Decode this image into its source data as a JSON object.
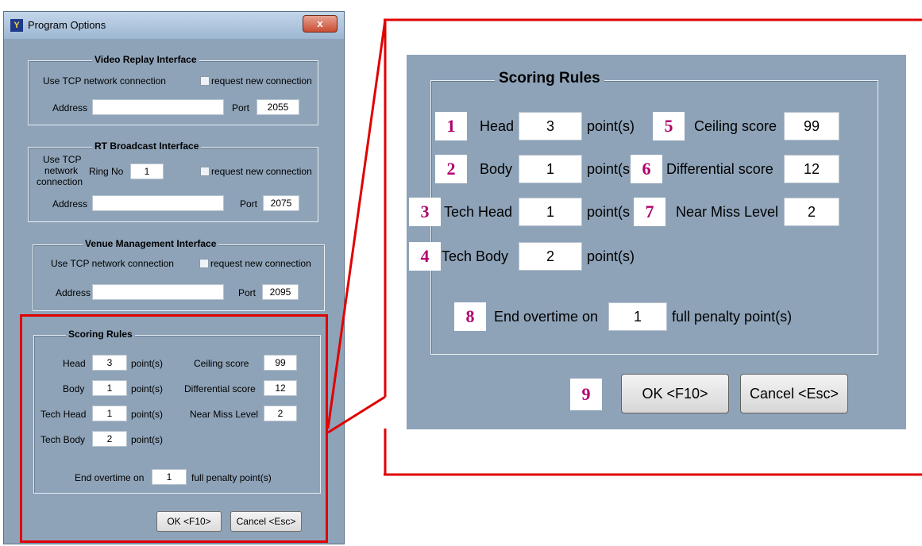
{
  "window": {
    "title": "Program Options",
    "close": "x",
    "app_icon": "app-icon"
  },
  "video": {
    "title": "Video Replay Interface",
    "use_tcp": "Use TCP network connection",
    "request": "request new connection",
    "address_label": "Address",
    "address_value": "",
    "port_label": "Port",
    "port_value": "2055"
  },
  "rt": {
    "title": "RT Broadcast Interface",
    "use_tcp_1": "Use TCP",
    "use_tcp_2": "network",
    "use_tcp_3": "connection",
    "ring_label": "Ring No",
    "ring_value": "1",
    "request": "request new connection",
    "address_label": "Address",
    "address_value": "",
    "port_label": "Port",
    "port_value": "2075"
  },
  "venue": {
    "title": "Venue Management Interface",
    "use_tcp": "Use TCP network connection",
    "request": "request new connection",
    "address_label": "Address",
    "address_value": "",
    "port_label": "Port",
    "port_value": "2095"
  },
  "scoring": {
    "title": "Scoring Rules",
    "head_label": "Head",
    "head_value": "3",
    "body_label": "Body",
    "body_value": "1",
    "tech_head_label": "Tech Head",
    "tech_head_value": "1",
    "tech_body_label": "Tech Body",
    "tech_body_value": "2",
    "points": "point(s)",
    "points_cut": "point(s",
    "ceiling_label": "Ceiling score",
    "ceiling_value": "99",
    "diff_label": "Differential score",
    "diff_value": "12",
    "near_miss_label": "Near Miss Level",
    "near_miss_value": "2",
    "end_overtime_label": "End overtime on",
    "end_overtime_value": "1",
    "full_penalty": "full penalty point(s)"
  },
  "buttons": {
    "ok": "OK <F10>",
    "cancel": "Cancel <Esc>"
  },
  "callouts": [
    "1",
    "2",
    "3",
    "4",
    "5",
    "6",
    "7",
    "8",
    "9"
  ],
  "colors": {
    "dialog_bg": "#8ea3b8",
    "highlight": "#e00000",
    "callout_text": "#b0006e"
  }
}
